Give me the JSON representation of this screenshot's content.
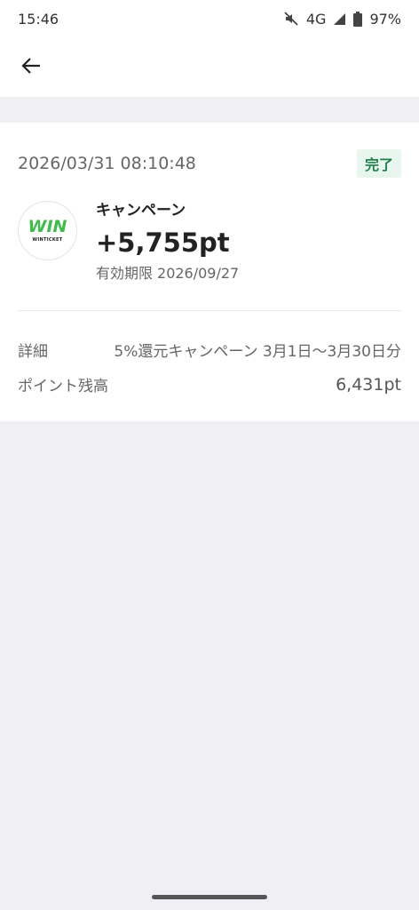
{
  "status": {
    "time": "15:46",
    "network": "4G",
    "battery": "97%",
    "icons": [
      "mute-icon",
      "signal-icon",
      "battery-icon"
    ]
  },
  "appbar": {
    "back_icon": "arrow-left-icon"
  },
  "transaction": {
    "datetime": "2026/03/31 08:10:48",
    "status_badge": "完了",
    "logo_text": "WIN",
    "logo_subtext": "WINTICKET",
    "campaign_name": "キャンペーン",
    "points": "+5,755pt",
    "expiry_label": "有効期限",
    "expiry_date": "2026/09/27",
    "details": {
      "label": "詳細",
      "value": "5%還元キャンペーン 3月1日〜3月30日分"
    },
    "balance": {
      "label": "ポイント残高",
      "value": "6,431pt"
    }
  },
  "colors": {
    "badge_bg": "#e9f6ef",
    "badge_text": "#1d8049",
    "logo_green": "#3fbd4a",
    "page_bg": "#efeff4"
  }
}
